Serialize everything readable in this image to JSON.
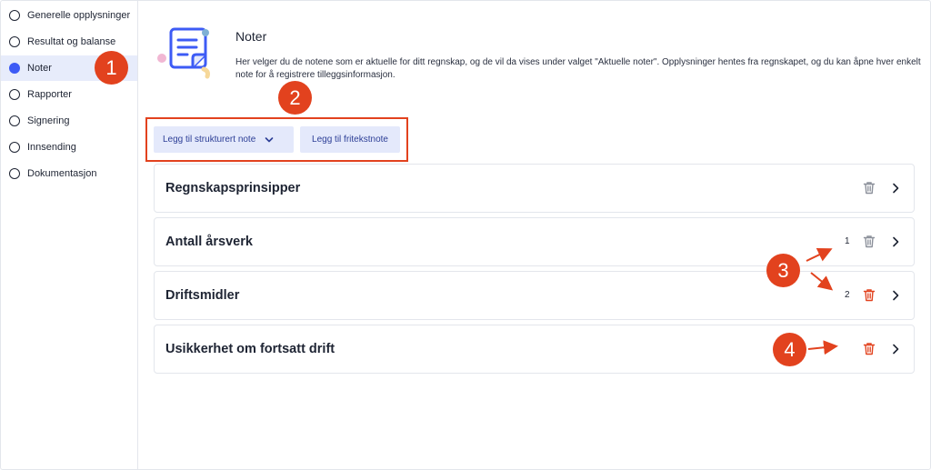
{
  "sidebar": {
    "items": [
      {
        "label": "Generelle opplysninger",
        "active": false
      },
      {
        "label": "Resultat og balanse",
        "active": false
      },
      {
        "label": "Noter",
        "active": true
      },
      {
        "label": "Rapporter",
        "active": false
      },
      {
        "label": "Signering",
        "active": false
      },
      {
        "label": "Innsending",
        "active": false
      },
      {
        "label": "Dokumentasjon",
        "active": false
      }
    ]
  },
  "header": {
    "title": "Noter",
    "description": "Her velger du de notene som er aktuelle for ditt regnskap, og de vil da vises under valget \"Aktuelle noter\". Opplysninger hentes fra regnskapet, og du kan åpne hver enkelt note for å registrere tilleggsinformasjon."
  },
  "toolbar": {
    "add_structured_label": "Legg til strukturert note",
    "add_freetext_label": "Legg til fritekstnote"
  },
  "notes": [
    {
      "title": "Regnskapsprinsipper",
      "count": "",
      "trash_color": "#8b909a"
    },
    {
      "title": "Antall årsverk",
      "count": "1",
      "trash_color": "#8b909a"
    },
    {
      "title": "Driftsmidler",
      "count": "2",
      "trash_color": "#e2421e"
    },
    {
      "title": "Usikkerhet om fortsatt drift",
      "count": "",
      "trash_color": "#e2421e"
    }
  ],
  "annotations": {
    "badge_1": "1",
    "badge_2": "2",
    "badge_3": "3",
    "badge_4": "4",
    "color": "#e2421e"
  },
  "colors": {
    "accent": "#3d5bf5",
    "button_bg": "#e4e9fb",
    "button_text": "#2c3e96",
    "active_nav_bg": "#e7ecfb"
  }
}
